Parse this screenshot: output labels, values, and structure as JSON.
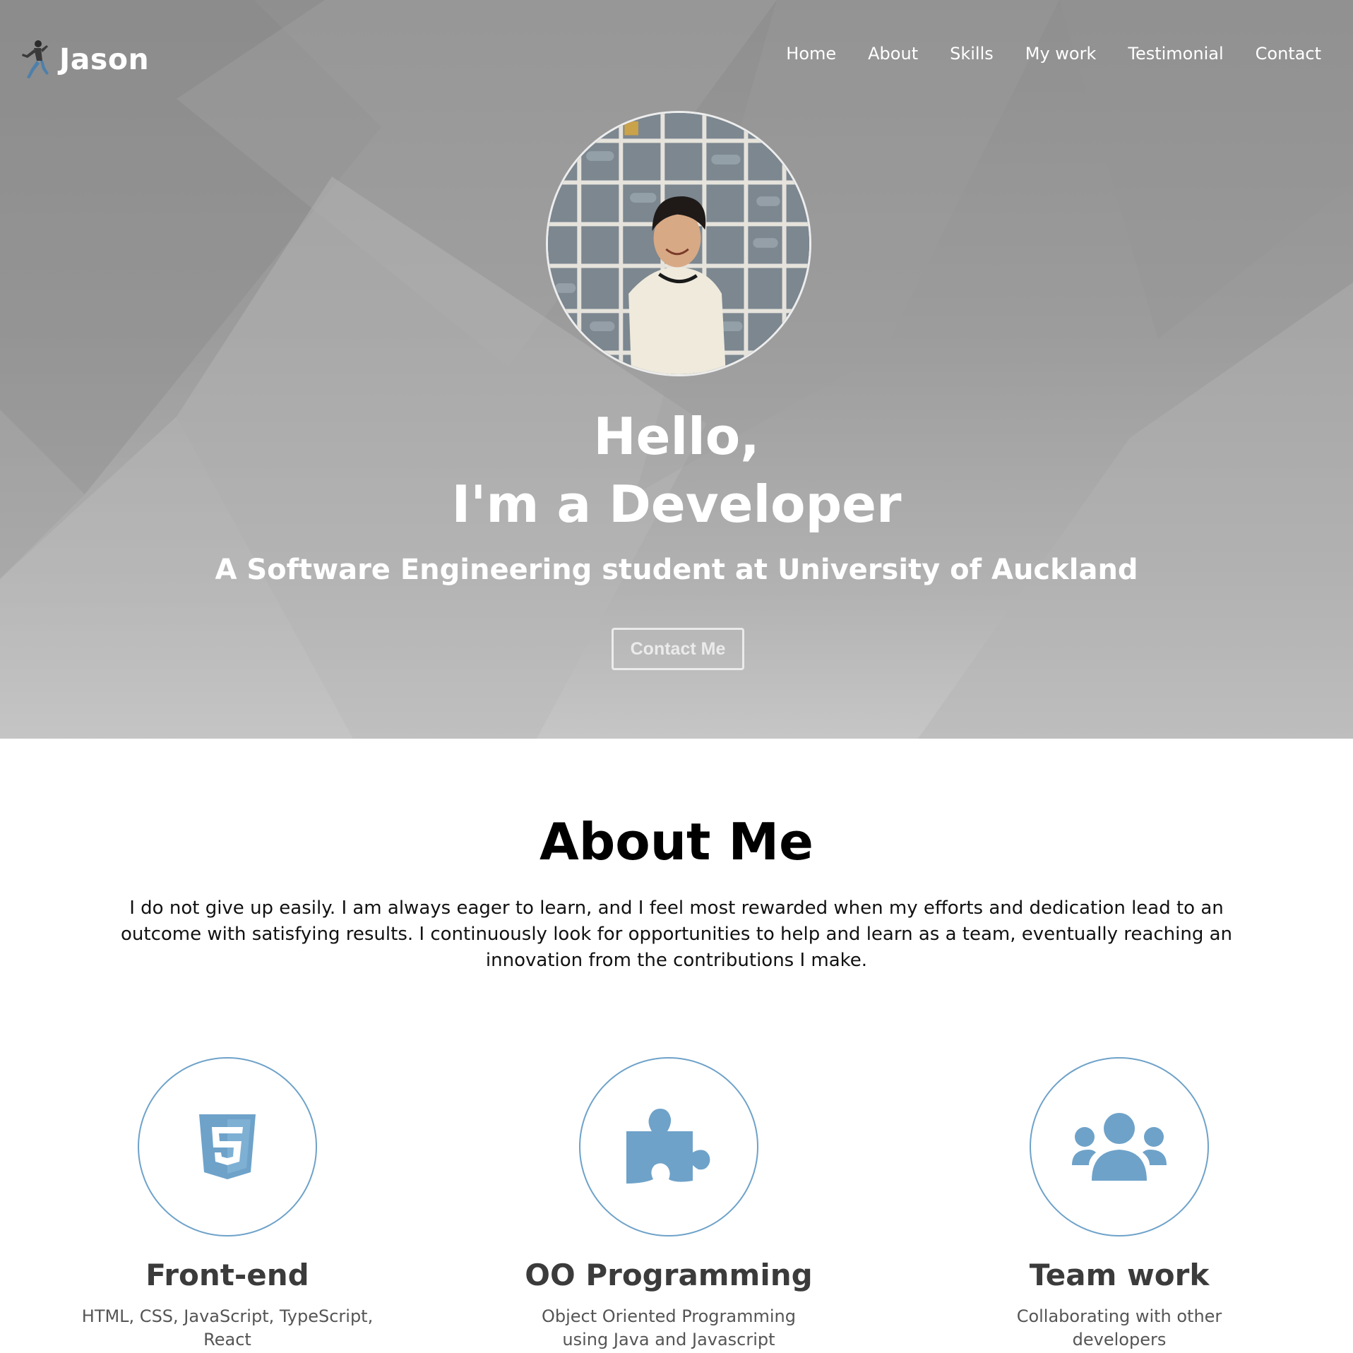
{
  "brand": {
    "name": "Jason",
    "logo_icon": "runner-icon"
  },
  "nav": {
    "items": [
      {
        "label": "Home"
      },
      {
        "label": "About"
      },
      {
        "label": "Skills"
      },
      {
        "label": "My work"
      },
      {
        "label": "Testimonial"
      },
      {
        "label": "Contact"
      }
    ]
  },
  "hero": {
    "avatar": "profile-photo",
    "greeting_line1": "Hello,",
    "greeting_line2": "I'm a Developer",
    "subtitle": "A Software Engineering student at University of Auckland",
    "cta_label": "Contact Me"
  },
  "about": {
    "title": "About Me",
    "text": "I do not give up easily. I am always eager to learn, and I feel most rewarded when my efforts and dedication lead to an outcome with satisfying results. I continuously look for opportunities to help and learn as a team, eventually reaching an innovation from the contributions I make."
  },
  "features": [
    {
      "icon": "html5-icon",
      "title": "Front-end",
      "desc": "HTML, CSS, JavaScript, TypeScript, React"
    },
    {
      "icon": "puzzle-icon",
      "title": "OO Programming",
      "desc": "Object Oriented Programming using Java and Javascript"
    },
    {
      "icon": "users-icon",
      "title": "Team work",
      "desc": "Collaborating with other developers"
    }
  ],
  "colors": {
    "accent": "#6ea2c9",
    "hero_bg": "#9a9a9a"
  }
}
